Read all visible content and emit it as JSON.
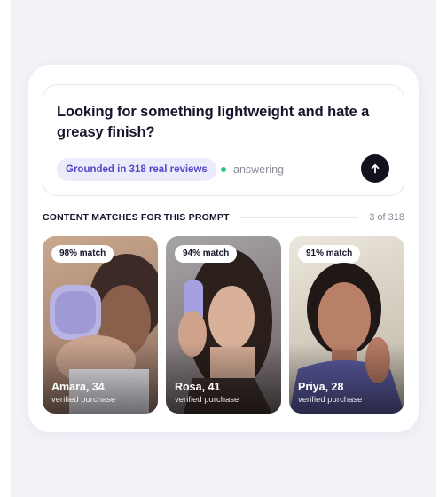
{
  "prompt": {
    "text": "Looking for something lightweight and hate a greasy finish?",
    "grounded_label": "Grounded in 318 real reviews",
    "status_label": "answering",
    "send_icon": "arrow-up-icon"
  },
  "section": {
    "title": "CONTENT MATCHES FOR THIS PROMPT",
    "count": "3 of 318"
  },
  "matches": [
    {
      "match": "98% match",
      "name": "Amara, 34",
      "sub": "verified purchase"
    },
    {
      "match": "94% match",
      "name": "Rosa, 41",
      "sub": "verified purchase"
    },
    {
      "match": "91% match",
      "name": "Priya, 28",
      "sub": "verified purchase"
    }
  ],
  "colors": {
    "accent": "#5447c9",
    "pill_bg": "#ecebfb",
    "status_dot": "#2fbf8a",
    "send_button": "#12121e"
  }
}
